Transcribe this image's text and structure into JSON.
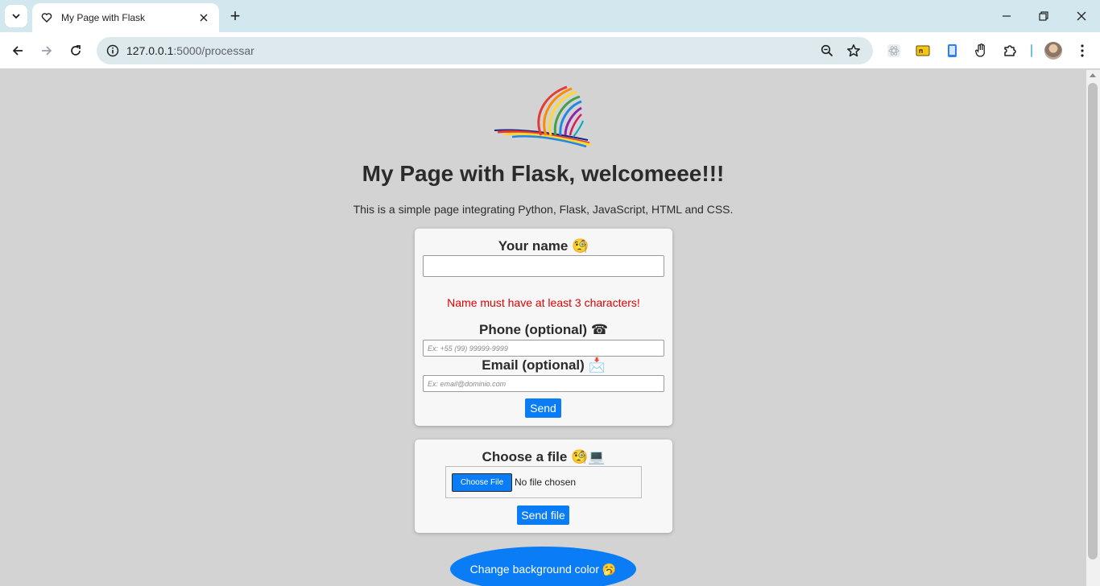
{
  "browser": {
    "tab_title": "My Page with Flask",
    "url_host": "127.0.0.1",
    "url_path": ":5000/processar",
    "new_tab_symbol": "+"
  },
  "page": {
    "title": "My Page with Flask, welcomeee!!!",
    "intro": "This is a simple page integrating Python, Flask, JavaScript, HTML and CSS."
  },
  "form": {
    "name_label": "Your name",
    "name_emoji": "🧐",
    "name_value": "",
    "error": "Name must have at least 3 characters!",
    "phone_label": "Phone (optional)",
    "phone_emoji": "☎",
    "phone_placeholder": "Ex: +55 (99) 99999-9999",
    "email_label": "Email (optional)",
    "email_emoji": "📩",
    "email_placeholder": "Ex: email@dominio.com",
    "send_label": "Send"
  },
  "file_form": {
    "label": "Choose a file",
    "emoji": "🧐💻",
    "choose_label": "Choose File",
    "no_file": "No file chosen",
    "send_label": "Send file"
  },
  "bg_button": {
    "label": "Change background color 🥱"
  },
  "colors": {
    "accent": "#0a7cf5",
    "error": "#e00000",
    "page_background": "#d3d3d3",
    "card_background": "#f7f7f7"
  }
}
